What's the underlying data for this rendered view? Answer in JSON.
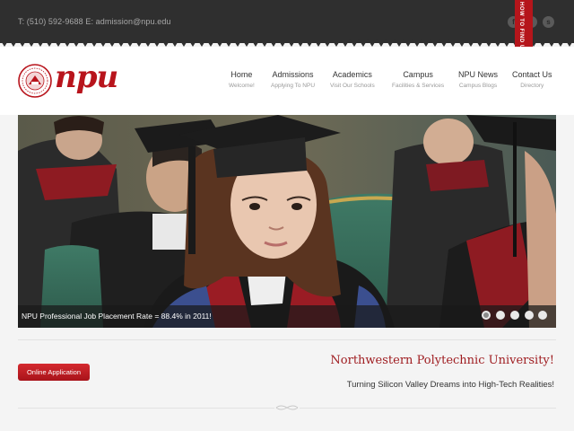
{
  "topbar": {
    "contact": "T: (510) 592-9688 E: admission@npu.edu",
    "social": [
      {
        "icon": "facebook-icon",
        "glyph": "f"
      },
      {
        "icon": "twitter-icon",
        "glyph": "t"
      },
      {
        "icon": "skype-icon",
        "glyph": "s"
      }
    ],
    "ribbon": "HOW TO FIND US"
  },
  "logo": {
    "text": "npu"
  },
  "nav": [
    {
      "title": "Home",
      "sub": "Welcome!"
    },
    {
      "title": "Admissions",
      "sub": "Applying To NPU"
    },
    {
      "title": "Academics",
      "sub": "Visit Our Schools"
    },
    {
      "title": "Campus",
      "sub": "Facilities & Services"
    },
    {
      "title": "NPU News",
      "sub": "Campus Blogs"
    },
    {
      "title": "Contact Us",
      "sub": "Directory"
    }
  ],
  "slider": {
    "caption": "NPU Professional Job Placement Rate = 88.4% in 2011!",
    "slide_count": 5,
    "active_slide": 1
  },
  "cta": {
    "button": "Online Application"
  },
  "intro": {
    "heading": "Northwestern Polytechnic University!",
    "tagline": "Turning Silicon Valley Dreams into High-Tech Realities!"
  },
  "colors": {
    "brand_red": "#b8141c",
    "topbar": "#2f2f2f"
  }
}
